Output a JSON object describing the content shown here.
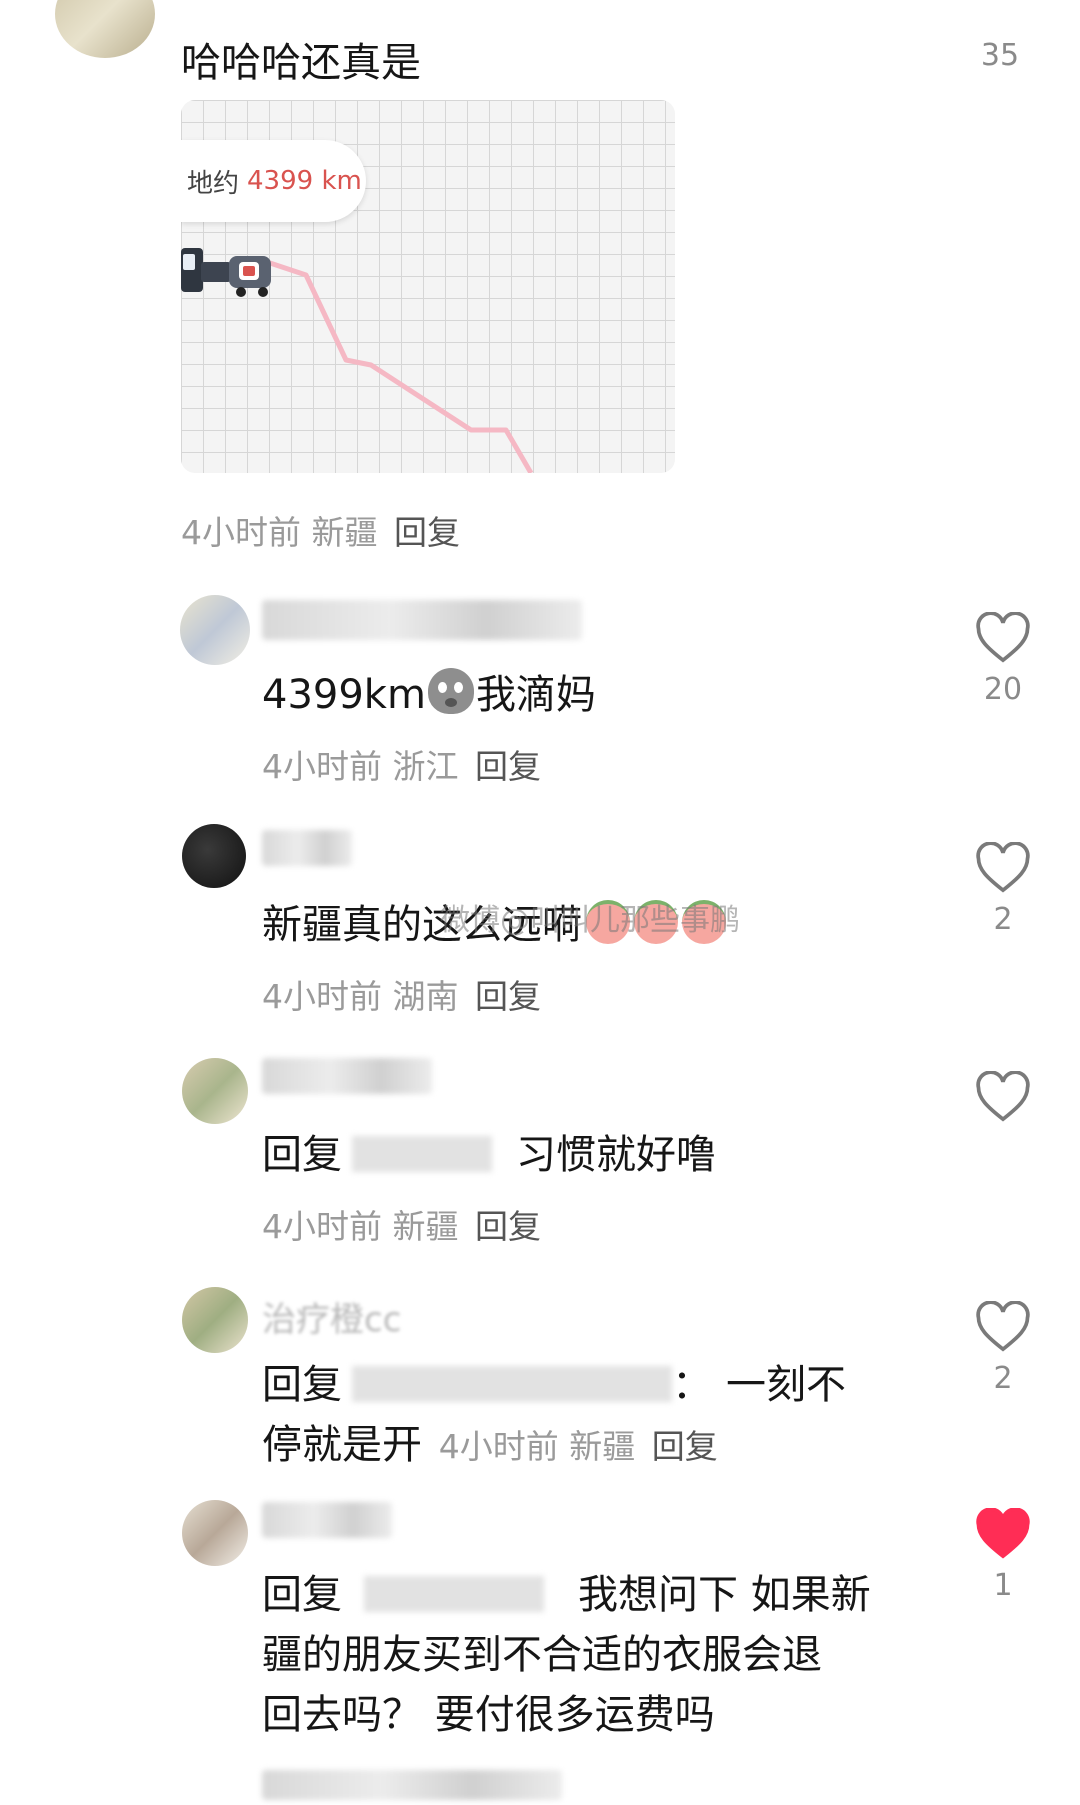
{
  "first_comment": {
    "text": "哈哈哈还真是",
    "like_count": "35",
    "map": {
      "distance_prefix": "地约",
      "distance_value": "4399 km"
    },
    "meta": {
      "time": "4小时前",
      "location": "新疆",
      "reply": "回复"
    }
  },
  "comments": [
    {
      "text": "4399km",
      "text_suffix": "我滴妈",
      "emoji": "ghost-face-emoji",
      "meta": {
        "time": "4小时前",
        "location": "浙江",
        "reply": "回复"
      },
      "like_count": "20",
      "liked": false
    },
    {
      "text": "新疆真的这么远嗬",
      "meta": {
        "time": "4小时前",
        "location": "湖南",
        "reply": "回复"
      },
      "like_count": "2",
      "liked": false
    },
    {
      "text_prefix": "回复",
      "text": "习惯就好噜",
      "meta": {
        "time": "4小时前",
        "location": "新疆",
        "reply": "回复"
      },
      "like_count": "",
      "liked": false
    },
    {
      "username": "治疗橙cc",
      "text_prefix": "回复",
      "text_colon": "：",
      "text_line1": "一刻不",
      "text_line2": "停就是开",
      "meta": {
        "time": "4小时前",
        "location": "新疆",
        "reply": "回复"
      },
      "like_count": "2",
      "liked": false
    },
    {
      "text_prefix": "回复",
      "text_line1": "我想问下 如果新",
      "text_line2": "疆的朋友买到不合适的衣服会退",
      "text_line3": "回去吗？ 要付很多运费吗",
      "like_count": "1",
      "liked": true
    }
  ],
  "watermark": "微博@叫叫儿那些事鹏",
  "colors": {
    "like_active": "#ff2d55",
    "route": "#f5b8c4"
  }
}
